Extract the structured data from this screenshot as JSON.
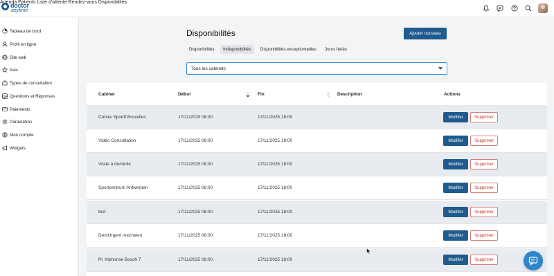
{
  "logo": {
    "line1": "doctor",
    "line2": "anytime"
  },
  "topnav": {
    "items": [
      "Agenda",
      "Patients",
      "Liste d'attente",
      "Rendez-vous",
      "Disponibilités"
    ]
  },
  "sidebar": {
    "items": [
      {
        "label": "Tableau de bord",
        "icon": "dashboard-icon"
      },
      {
        "label": "Profil en ligne",
        "icon": "user-icon"
      },
      {
        "label": "Site web",
        "icon": "globe-icon"
      },
      {
        "label": "Avis",
        "icon": "star-icon"
      },
      {
        "label": "Types de consultation",
        "icon": "briefcase-icon"
      },
      {
        "label": "Questions et Réponses",
        "icon": "qa-icon"
      },
      {
        "label": "Paiements",
        "icon": "card-icon"
      },
      {
        "label": "Paramètres",
        "icon": "gear-icon"
      },
      {
        "label": "Mon compte",
        "icon": "account-icon"
      },
      {
        "label": "Widgets",
        "icon": "megaphone-icon"
      }
    ]
  },
  "main": {
    "title": "Disponibilités",
    "add_label": "Ajouter nouveau",
    "tabs": [
      {
        "label": "Disponibilités",
        "active": false
      },
      {
        "label": "Indisponibilités",
        "active": true
      },
      {
        "label": "Disponibilités exceptionnelles",
        "active": false
      },
      {
        "label": "Jours fériés",
        "active": false
      }
    ],
    "filter": {
      "value": "Tous les cabinets"
    }
  },
  "table": {
    "headers": {
      "cabinet": "Cabinet",
      "debut": "Début",
      "fin": "Fin",
      "description": "Description",
      "actions": "Actions"
    },
    "modify_label": "Modifier",
    "delete_label": "Supprimer",
    "rows": [
      {
        "cabinet": "Centre Sportif Bruxelles",
        "debut": "17/11/2025 08:00",
        "fin": "17/11/2025 18:00",
        "description": ""
      },
      {
        "cabinet": "Vidéo Consultation",
        "debut": "17/11/2025 08:00",
        "fin": "17/11/2025 18:00",
        "description": ""
      },
      {
        "cabinet": "Visite à domicile",
        "debut": "17/11/2025 08:00",
        "fin": "17/11/2025 18:00",
        "description": ""
      },
      {
        "cabinet": "Sportcentrum Antwerpen",
        "debut": "17/11/2025 08:00",
        "fin": "17/11/2025 18:00",
        "description": ""
      },
      {
        "cabinet": "test",
        "debut": "17/11/2025 08:00",
        "fin": "17/11/2025 18:00",
        "description": ""
      },
      {
        "cabinet": "DentUrgent mechelen",
        "debut": "17/11/2025 08:00",
        "fin": "17/11/2025 18:00",
        "description": ""
      },
      {
        "cabinet": "Pl. Alphonse Bosch 7",
        "debut": "17/11/2025 08:00",
        "fin": "17/11/2025 18:00",
        "description": ""
      }
    ]
  },
  "colors": {
    "primary": "#1e5b8e",
    "danger": "#c0392b",
    "chat": "#2e86c9"
  }
}
